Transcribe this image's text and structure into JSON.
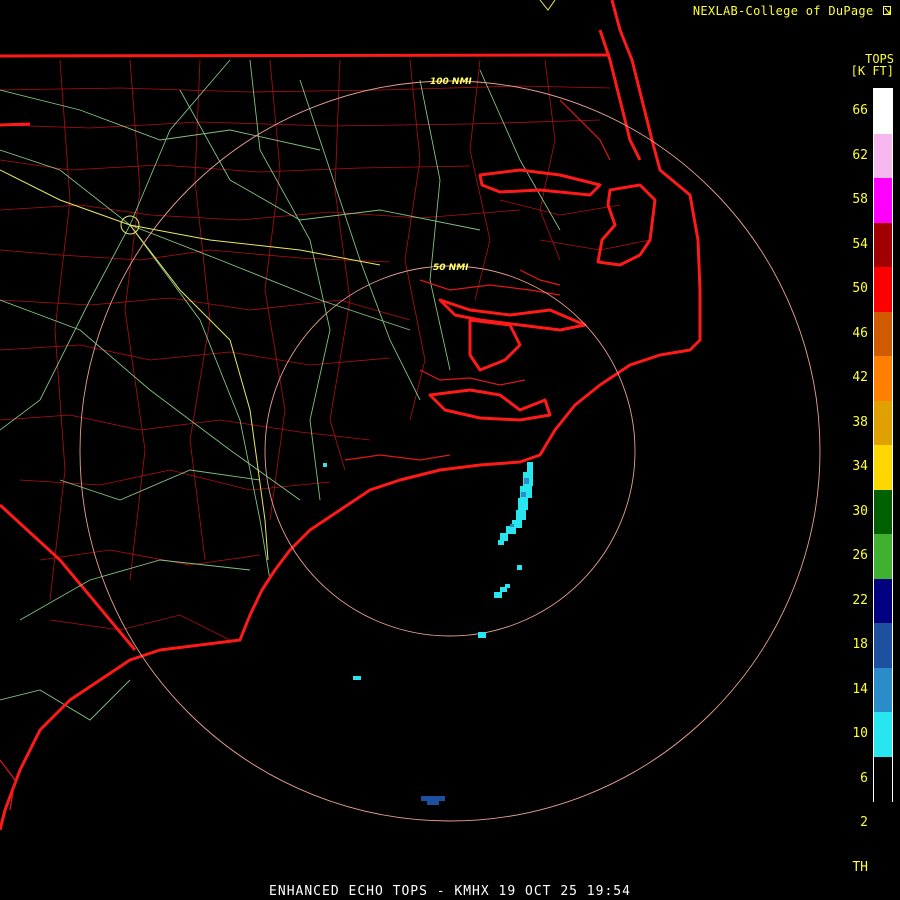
{
  "credit": "NEXLAB-College of DuPage",
  "legend": {
    "title_line1": "TOPS",
    "title_line2": "[K FT]",
    "ticks": [
      "66",
      "62",
      "58",
      "54",
      "50",
      "46",
      "42",
      "38",
      "34",
      "30",
      "26",
      "22",
      "18",
      "14",
      "10",
      "6",
      "2",
      "TH"
    ],
    "colors": [
      "#ffffff",
      "#f7b8f0",
      "#ff00ff",
      "#a00000",
      "#ff0000",
      "#d05a00",
      "#ff7f00",
      "#e0a000",
      "#ffd700",
      "#006000",
      "#40b030",
      "#000080",
      "#1e50a0",
      "#2a8cc8",
      "#28e6f0",
      "#000000"
    ]
  },
  "range_rings": {
    "inner_label": "50 NMI",
    "outer_label": "100 NMI"
  },
  "footer": "ENHANCED ECHO TOPS - KMHX 19 OCT 25 19:54",
  "icons": {
    "credit_logo": "arrow-logo-icon"
  }
}
